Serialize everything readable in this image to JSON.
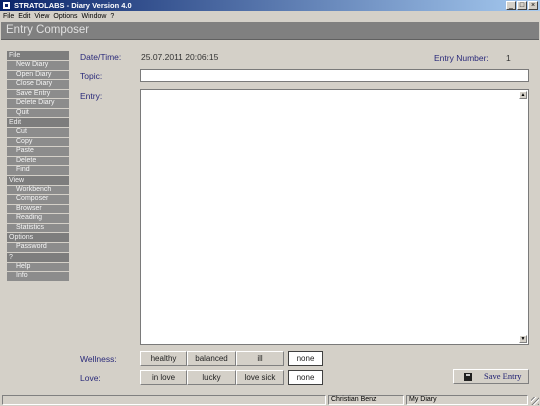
{
  "window": {
    "title": "STRATOLABS - Diary Version 4.0",
    "controls": {
      "minimize": "_",
      "restore": "□",
      "close": "×"
    }
  },
  "menubar": [
    "File",
    "Edit",
    "View",
    "Options",
    "Window",
    "?"
  ],
  "header": {
    "title": "Entry Composer"
  },
  "sidebar": {
    "groups": [
      {
        "label": "File",
        "items": [
          "New Diary",
          "Open Diary",
          "Close Diary",
          "Save Entry",
          "Delete Diary",
          "Quit"
        ]
      },
      {
        "label": "Edit",
        "items": [
          "Cut",
          "Copy",
          "Paste",
          "Delete",
          "Find"
        ]
      },
      {
        "label": "View",
        "items": [
          "Workbench",
          "Composer",
          "Browser",
          "Reading",
          "Statistics"
        ]
      },
      {
        "label": "Options",
        "items": [
          "Password"
        ]
      },
      {
        "label": "?",
        "items": [
          "Help",
          "Info"
        ]
      }
    ]
  },
  "form": {
    "datetime_label": "Date/Time:",
    "datetime_value": "25.07.2011 20:06:15",
    "entry_number_label": "Entry Number:",
    "entry_number_value": "1",
    "topic_label": "Topic:",
    "topic_value": "",
    "entry_label": "Entry:",
    "entry_value": ""
  },
  "wellness": {
    "label": "Wellness:",
    "options": [
      "healthy",
      "balanced",
      "ill",
      "none"
    ],
    "selected": "none"
  },
  "love": {
    "label": "Love:",
    "options": [
      "in love",
      "lucky",
      "love sick",
      "none"
    ],
    "selected": "none"
  },
  "save_button": {
    "label": "Save Entry"
  },
  "statusbar": {
    "user": "Christian Benz",
    "diary": "My Diary"
  }
}
